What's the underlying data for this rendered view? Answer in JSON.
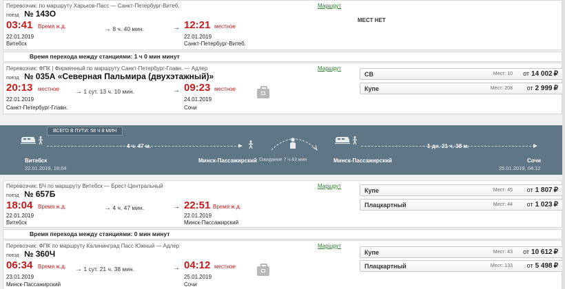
{
  "common": {
    "train_label": "поезд",
    "route_link": "Маршрут",
    "duration_arrow": "→",
    "seats_prefix": "Мест:",
    "price_from": "от",
    "currency": "₽"
  },
  "segment1": {
    "carrier": "Перевозчик:  по маршруту Харьков-Пасс — Санкт-Петербург-Витеб.",
    "train_number": "№ 143О",
    "dep_time": "03:41",
    "dep_note": "Время ж.д.",
    "dep_date": "22.01.2019",
    "dep_station": "Витебск",
    "duration": "8 ч. 40 мин.",
    "arr_time": "12:21",
    "arr_note": "местное",
    "arr_date": "22.01.2019",
    "arr_station": "Санкт-Петербург-Витеб.",
    "no_seats": "МЕСТ НЕТ"
  },
  "transfer1": "Время перехода между станциями: 1 ч 0 мин минут",
  "segment2": {
    "carrier": "Перевозчик: ФПК | Фирменный   по маршруту Санкт-Петербург-Главн. — Адлер",
    "train_number": "№ 035А «Северная Пальмира (двухэтажный)»",
    "dep_time": "20:13",
    "dep_note": "местное",
    "dep_date": "22.01.2019",
    "dep_station": "Санкт-Петербург-Главн.",
    "duration": "1 сут. 13 ч. 10 мин.",
    "arr_time": "09:23",
    "arr_note": "местное",
    "arr_date": "24.01.2019",
    "arr_station": "Сочи",
    "fares": [
      {
        "class": "СВ",
        "seats": "10",
        "price": "14 002"
      },
      {
        "class": "Купе",
        "seats": "208",
        "price": "2 999"
      }
    ]
  },
  "summary": {
    "total": "ВСЕГО В ПУТИ: 58 Ч 8 МИН",
    "leg1_duration": "4 ч. 47 м.",
    "leg2_duration": "1 дн. 21 ч. 38 м.",
    "from_station": "Витебск",
    "from_date": "22.01.2019, 18:04",
    "mid_station_a": "Минск-Пассажирский",
    "wait": "Ожидание 7 ч 43 мин",
    "mid_station_b": "Минск-Пассажирский",
    "to_station": "Сочи",
    "to_date": "25.01.2019, 04:12"
  },
  "segment3": {
    "carrier": "Перевозчик: БЧ   по маршруту Витебск — Брест-Центральный",
    "train_number": "№ 657Б",
    "dep_time": "18:04",
    "dep_note": "Время ж.д.",
    "dep_date": "22.01.2019",
    "dep_station": "Витебск",
    "duration": "4 ч. 47 мин.",
    "arr_time": "22:51",
    "arr_note": "Время ж.д.",
    "arr_date": "22.01.2019",
    "arr_station": "Минск-Пассажирский",
    "fares": [
      {
        "class": "Купе",
        "seats": "45",
        "price": "1 807"
      },
      {
        "class": "Плацкартный",
        "seats": "44",
        "price": "1 023"
      }
    ]
  },
  "transfer2": "Время перехода между станциями: 0 мин минут",
  "segment4": {
    "carrier": "Перевозчик: ФПК   по маршруту Калининград Пасс Южный — Адлер",
    "train_number": "№ 360Ч",
    "dep_time": "06:34",
    "dep_note": "Время ж.д.",
    "dep_date": "23.01.2019",
    "dep_station": "Минск-Пассажирский",
    "duration": "1 сут. 21 ч. 38 мин.",
    "arr_time": "04:12",
    "arr_note": "местное",
    "arr_date": "25.01.2019",
    "arr_station": "Сочи",
    "fares": [
      {
        "class": "Купе",
        "seats": "43",
        "price": "10 612"
      },
      {
        "class": "Плацкартный",
        "seats": "133",
        "price": "5 498"
      }
    ]
  },
  "colors": {
    "time_red": "#c41a1a",
    "link_green": "#2d7a2d",
    "summary_bg": "#5f7687"
  }
}
